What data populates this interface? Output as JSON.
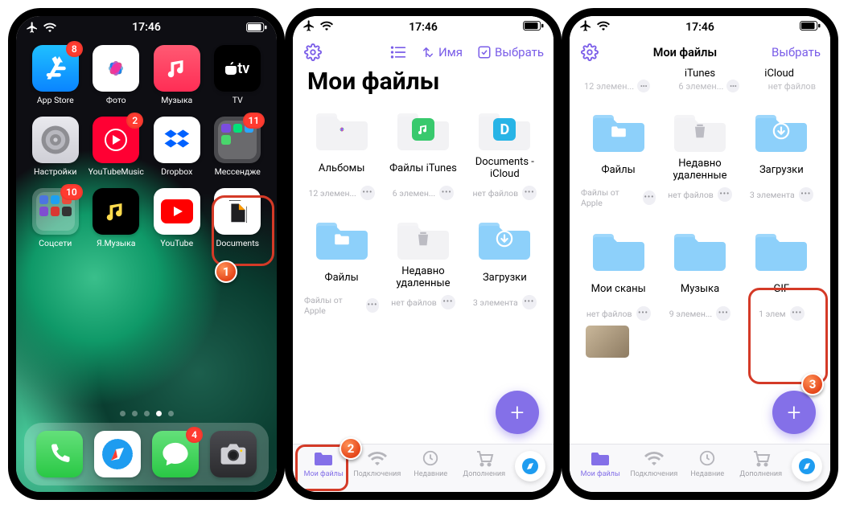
{
  "status": {
    "time": "17:46"
  },
  "colors": {
    "accent": "#8470e8",
    "highlight": "#d43a27"
  },
  "home": {
    "apps": [
      {
        "label": "App Store",
        "bg": "linear-gradient(180deg,#1fc0ff,#0a84ff)",
        "kind": "appstore",
        "badge": "8"
      },
      {
        "label": "Фото",
        "bg": "#fff",
        "kind": "photo"
      },
      {
        "label": "Музыка",
        "bg": "linear-gradient(180deg,#ff5a73,#ff2d55)",
        "kind": "music"
      },
      {
        "label": "TV",
        "bg": "#000",
        "kind": "tv"
      },
      {
        "label": "Настройки",
        "bg": "linear-gradient(180deg,#e9e9ee,#cfcfd6)",
        "kind": "settings"
      },
      {
        "label": "YouTubeMusic",
        "bg": "#ff0033",
        "kind": "ytmusic",
        "badge": "2"
      },
      {
        "label": "Dropbox",
        "bg": "#fff",
        "kind": "dropbox"
      },
      {
        "label": "Мессендже",
        "bg": "folder",
        "kind": "folder-msg",
        "badge": "11"
      },
      {
        "label": "Соцсети",
        "bg": "folder",
        "kind": "folder-soc",
        "badge": "10"
      },
      {
        "label": "Я.Музыка",
        "bg": "#000",
        "kind": "ymusic"
      },
      {
        "label": "YouTube",
        "bg": "#fff",
        "kind": "youtube"
      },
      {
        "label": "Documents",
        "bg": "#fff",
        "kind": "documents"
      }
    ],
    "dock": [
      {
        "label": "Phone",
        "bg": "linear-gradient(180deg,#64e07a,#2ac845)",
        "kind": "phone",
        "badge": null
      },
      {
        "label": "Safari",
        "bg": "#fff",
        "kind": "safari",
        "badge": null
      },
      {
        "label": "Messages",
        "bg": "linear-gradient(180deg,#64e07a,#2ac845)",
        "kind": "messages",
        "badge": "4"
      },
      {
        "label": "Camera",
        "bg": "linear-gradient(180deg,#4a4a4f,#2b2b2e)",
        "kind": "camera",
        "badge": null
      }
    ]
  },
  "docs2": {
    "toolbar": {
      "sort_label": "Имя",
      "select_label": "Выбрать"
    },
    "title": "Мои файлы",
    "folders": [
      {
        "name": "Альбомы",
        "meta": "12 элемен...",
        "icon": "photo",
        "bg": "#f2f2f4"
      },
      {
        "name": "Файлы iTunes",
        "meta": "6 элемен...",
        "icon": "itunes",
        "bg": "#f2f2f4"
      },
      {
        "name": "Documents - iCloud",
        "meta": "нет файлов",
        "icon": "icloud",
        "bg": "#f2f2f4"
      },
      {
        "name": "Файлы",
        "meta": "Файлы от Apple",
        "icon": "files",
        "bg": "#8dd0fa"
      },
      {
        "name": "Недавно удаленные",
        "meta": "нет файлов",
        "icon": "trash",
        "bg": "#f2f2f4"
      },
      {
        "name": "Загрузки",
        "meta": "3 элемента",
        "icon": "download",
        "bg": "#8dd0fa"
      }
    ],
    "tabs": [
      {
        "label": "Мои файлы",
        "icon": "files",
        "active": true
      },
      {
        "label": "Подключения",
        "icon": "wifi"
      },
      {
        "label": "Недавние",
        "icon": "clock"
      },
      {
        "label": "Дополнения",
        "icon": "cart"
      }
    ]
  },
  "docs3": {
    "title": "Мои файлы",
    "select_label": "Выбрать",
    "top_row_labels": {
      "c1": "iTunes",
      "c2": "iCloud"
    },
    "meta_row": {
      "c1": "12 элемен...",
      "c2": "6 элемен...",
      "c3": "нет файлов"
    },
    "folders1": [
      {
        "name": "Файлы",
        "meta": "Файлы от Apple",
        "icon": "files",
        "bg": "#8dd0fa"
      },
      {
        "name": "Недавно удаленные",
        "meta": "нет файлов",
        "icon": "trash",
        "bg": "#f2f2f4"
      },
      {
        "name": "Загрузки",
        "meta": "3 элемента",
        "icon": "download",
        "bg": "#8dd0fa"
      }
    ],
    "folders2": [
      {
        "name": "Мои сканы",
        "meta": "нет файлов",
        "bg": "#8dd0fa"
      },
      {
        "name": "Музыка",
        "meta": "9 элемен...",
        "bg": "#8dd0fa"
      },
      {
        "name": "GIF",
        "meta": "1 элем",
        "bg": "#8dd0fa"
      }
    ],
    "tabs": [
      {
        "label": "Мои файлы",
        "icon": "files",
        "active": true
      },
      {
        "label": "Подключения",
        "icon": "wifi"
      },
      {
        "label": "Недавние",
        "icon": "clock"
      },
      {
        "label": "Дополнения",
        "icon": "cart"
      }
    ]
  },
  "callouts": {
    "one": "1",
    "two": "2",
    "three": "3"
  }
}
